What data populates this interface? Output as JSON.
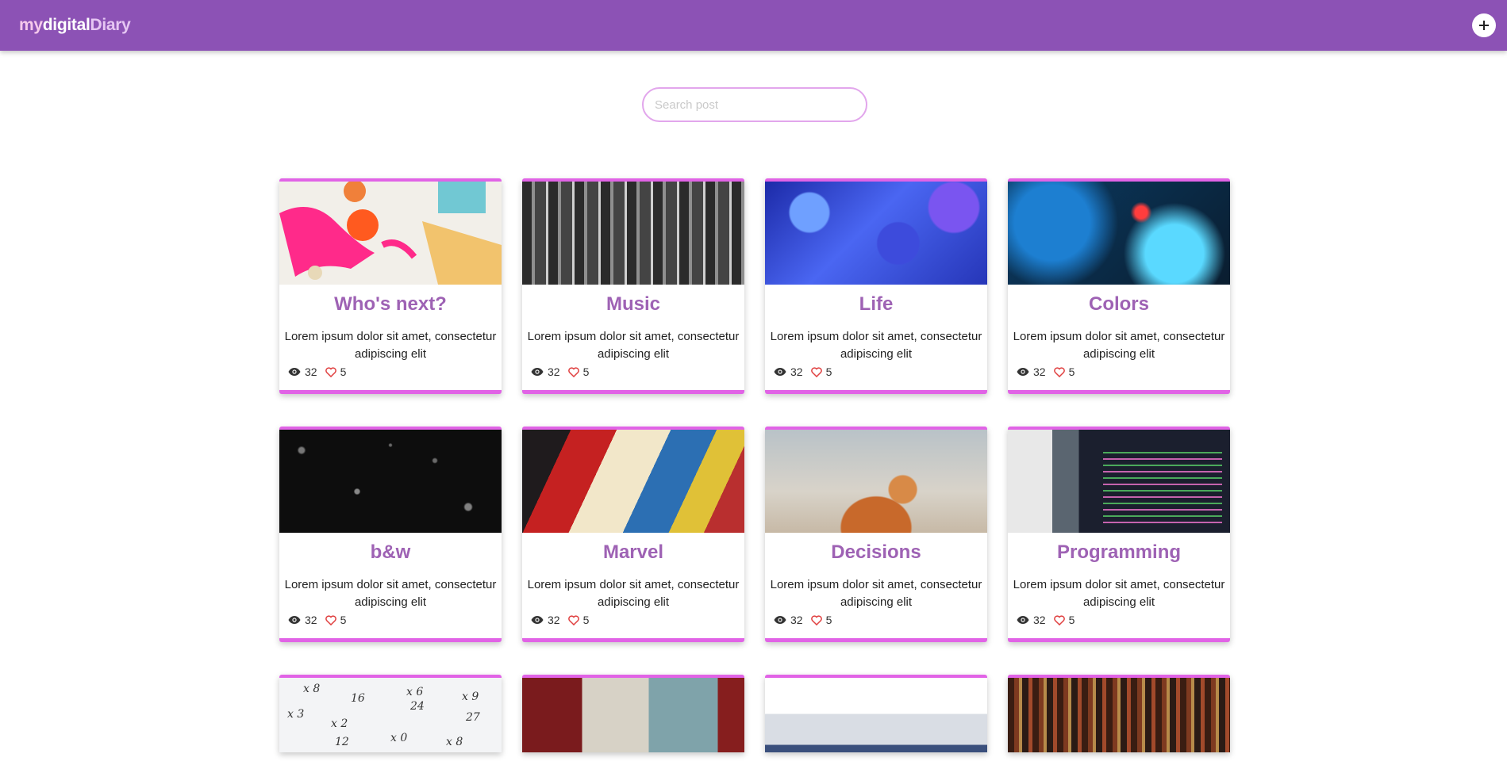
{
  "header": {
    "brand_part1": "my",
    "brand_part2": "digital",
    "brand_part3": "Diary",
    "add_button_label": "+"
  },
  "search": {
    "placeholder": "Search post",
    "value": ""
  },
  "posts": [
    {
      "title": "Who's next?",
      "description": "Lorem ipsum dolor sit amet, consectetur adipiscing elit",
      "views": "32",
      "likes": "5",
      "image": "paint-splatter"
    },
    {
      "title": "Music",
      "description": "Lorem ipsum dolor sit amet, consectetur adipiscing elit",
      "views": "32",
      "likes": "5",
      "image": "chairs"
    },
    {
      "title": "Life",
      "description": "Lorem ipsum dolor sit amet, consectetur adipiscing elit",
      "views": "32",
      "likes": "5",
      "image": "blue-flowers"
    },
    {
      "title": "Colors",
      "description": "Lorem ipsum dolor sit amet, consectetur adipiscing elit",
      "views": "32",
      "likes": "5",
      "image": "color-smoke"
    },
    {
      "title": "b&w",
      "description": "Lorem ipsum dolor sit amet, consectetur adipiscing elit",
      "views": "32",
      "likes": "5",
      "image": "water-drops"
    },
    {
      "title": "Marvel",
      "description": "Lorem ipsum dolor sit amet, consectetur adipiscing elit",
      "views": "32",
      "likes": "5",
      "image": "comics"
    },
    {
      "title": "Decisions",
      "description": "Lorem ipsum dolor sit amet, consectetur adipiscing elit",
      "views": "32",
      "likes": "5",
      "image": "shiba-dog"
    },
    {
      "title": "Programming",
      "description": "Lorem ipsum dolor sit amet, consectetur adipiscing elit",
      "views": "32",
      "likes": "5",
      "image": "code-laptop"
    }
  ],
  "partial_posts": [
    {
      "image": "math-worksheet"
    },
    {
      "image": "lockers"
    },
    {
      "image": "university"
    },
    {
      "image": "bookshelf"
    }
  ],
  "colors": {
    "header_bg": "#8c52b5",
    "card_accent": "#e163e6",
    "title_color": "#9e62b4",
    "heart_color": "#e04040"
  },
  "icons": {
    "views": "eye-icon",
    "likes": "heart-icon",
    "add": "plus-icon"
  }
}
